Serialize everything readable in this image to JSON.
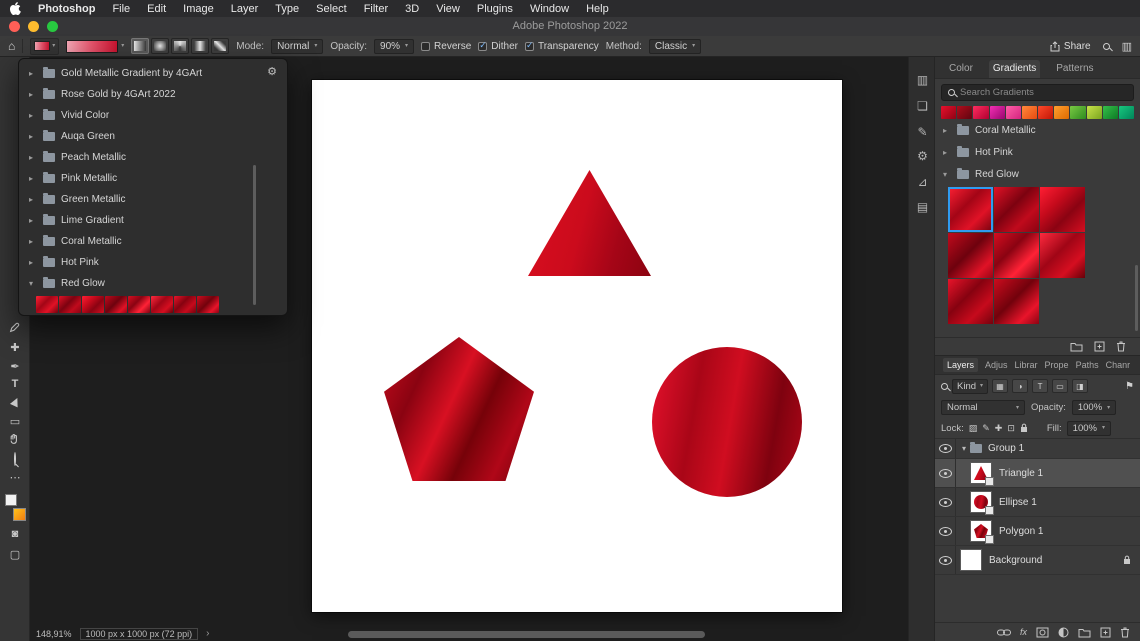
{
  "menubar": {
    "app_name": "Photoshop",
    "items": [
      "File",
      "Edit",
      "Image",
      "Layer",
      "Type",
      "Select",
      "Filter",
      "3D",
      "View",
      "Plugins",
      "Window",
      "Help"
    ],
    "window_title": "Adobe Photoshop 2022"
  },
  "options_bar": {
    "mode_label": "Mode:",
    "mode_value": "Normal",
    "opacity_label": "Opacity:",
    "opacity_value": "90%",
    "reverse_label": "Reverse",
    "dither_label": "Dither",
    "transparency_label": "Transparency",
    "method_label": "Method:",
    "method_value": "Classic",
    "share_label": "Share",
    "gradient_preview": {
      "angle": 90,
      "stops": [
        "#f2a6b4 0%",
        "#e4536b 50%",
        "#c81430 100%"
      ]
    }
  },
  "gradient_picker": {
    "folders": [
      {
        "label": "Gold Metallic Gradient by 4GArt"
      },
      {
        "label": "Rose Gold by 4GArt 2022"
      },
      {
        "label": "Vivid Color"
      },
      {
        "label": "Auqa Green"
      },
      {
        "label": "Peach Metallic"
      },
      {
        "label": "Pink Metallic"
      },
      {
        "label": "Green Metallic"
      },
      {
        "label": "Lime Gradient"
      },
      {
        "label": "Coral Metallic"
      },
      {
        "label": "Hot Pink"
      },
      {
        "label": "Red Glow"
      }
    ],
    "red_swatches": [
      [
        "#ff2134 0%",
        "#a30516 40%",
        "#e01226 68%",
        "#70020d 100%"
      ],
      [
        "#e01226 0%",
        "#7c0210 42%",
        "#c00a1c 70%",
        "#8a0312 100%"
      ],
      [
        "#ff1e33 0%",
        "#c60a1c 35%",
        "#8a0312 62%",
        "#d50e20 100%"
      ],
      [
        "#c00a1c 0%",
        "#6e020e 45%",
        "#e01226 78%",
        "#9a0415 100%"
      ],
      [
        "#d50e20 0%",
        "#8a0312 38%",
        "#ff2236 68%",
        "#7c0210 100%"
      ],
      [
        "#ff2a3e 0%",
        "#a00516 42%",
        "#d50e20 72%",
        "#660109 100%"
      ],
      [
        "#e8142a 0%",
        "#860210 40%",
        "#c60a1c 70%",
        "#74020d 100%"
      ],
      [
        "#cc0c1e 0%",
        "#72020c 45%",
        "#e8142a 76%",
        "#8a0312 100%"
      ]
    ]
  },
  "gradients_panel": {
    "tabs": [
      "Color",
      "Gradients",
      "Patterns"
    ],
    "search_placeholder": "Search Gradients",
    "top_swatches": [
      [
        "#e8102c",
        "#8f0214"
      ],
      [
        "#b00d1c",
        "#5f0510"
      ],
      [
        "#ff2d60",
        "#b00030"
      ],
      [
        "#f32fb4",
        "#98056e"
      ],
      [
        "#ff5fa8",
        "#d4247f"
      ],
      [
        "#ff8a3c",
        "#e84a10"
      ],
      [
        "#ff4a2a",
        "#c21606"
      ],
      [
        "#ffa030",
        "#e06a00"
      ],
      [
        "#7ac943",
        "#2e8b1f"
      ],
      [
        "#c8e24a",
        "#7aa51e"
      ],
      [
        "#35c04a",
        "#0c7a24"
      ],
      [
        "#18c87e",
        "#00855a"
      ]
    ],
    "folders": [
      {
        "label": "Coral Metallic"
      },
      {
        "label": "Hot Pink"
      },
      {
        "label": "Red Glow"
      }
    ],
    "red_glow_swatches": [
      [
        "#ff2134 0%",
        "#a30516 40%",
        "#e01226 68%",
        "#70020d 100%"
      ],
      [
        "#e01226 0%",
        "#7c0210 42%",
        "#c00a1c 70%",
        "#8a0312 100%"
      ],
      [
        "#ff1e33 0%",
        "#c60a1c 35%",
        "#8a0312 62%",
        "#d50e20 100%"
      ],
      [
        "#c00a1c 0%",
        "#6e020e 45%",
        "#e01226 78%",
        "#9a0415 100%"
      ],
      [
        "#d50e20 0%",
        "#8a0312 38%",
        "#ff2236 68%",
        "#7c0210 100%"
      ],
      [
        "#ff2a3e 0%",
        "#a00516 42%",
        "#d50e20 72%",
        "#660109 100%"
      ],
      [
        "#e8142a 0%",
        "#860210 40%",
        "#c60a1c 70%",
        "#74020d 100%"
      ],
      [
        "#cc0c1e 0%",
        "#72020c 45%",
        "#e8142a 76%",
        "#8a0312 100%"
      ]
    ],
    "selection_color": "#2f9bf0"
  },
  "layers_panel": {
    "tabs": [
      "Layers",
      "Adjus",
      "Librar",
      "Prope",
      "Paths",
      "Chanr"
    ],
    "kind_label": "Kind",
    "blend_mode": "Normal",
    "opacity_label": "Opacity:",
    "opacity_value": "100%",
    "lock_label": "Lock:",
    "fill_label": "Fill:",
    "fill_value": "100%",
    "layers": [
      {
        "name": "Group 1"
      },
      {
        "name": "Triangle 1"
      },
      {
        "name": "Ellipse 1"
      },
      {
        "name": "Polygon 1"
      },
      {
        "name": "Background"
      }
    ]
  },
  "canvas": {
    "triangle": {
      "angle": 105,
      "stops": [
        "#db0f20 0%",
        "#cb0b1c 45%",
        "#a50517 72%",
        "#8c0310 100%"
      ]
    },
    "pentagon": {
      "angle": 115,
      "stops": [
        "#c90c1d 0%",
        "#8a0311 25%",
        "#d81022 45%",
        "#760209 62%",
        "#b00718 80%",
        "#69010a 100%"
      ]
    },
    "ellipse": {
      "angle": 100,
      "stops": [
        "#e8112d 0%",
        "#a90617 30%",
        "#d00d20 52%",
        "#7e020f 78%",
        "#b00718 100%"
      ]
    }
  },
  "status_bar": {
    "zoom": "148,91%",
    "doc_size": "1000 px x 1000 px (72 ppi)"
  }
}
